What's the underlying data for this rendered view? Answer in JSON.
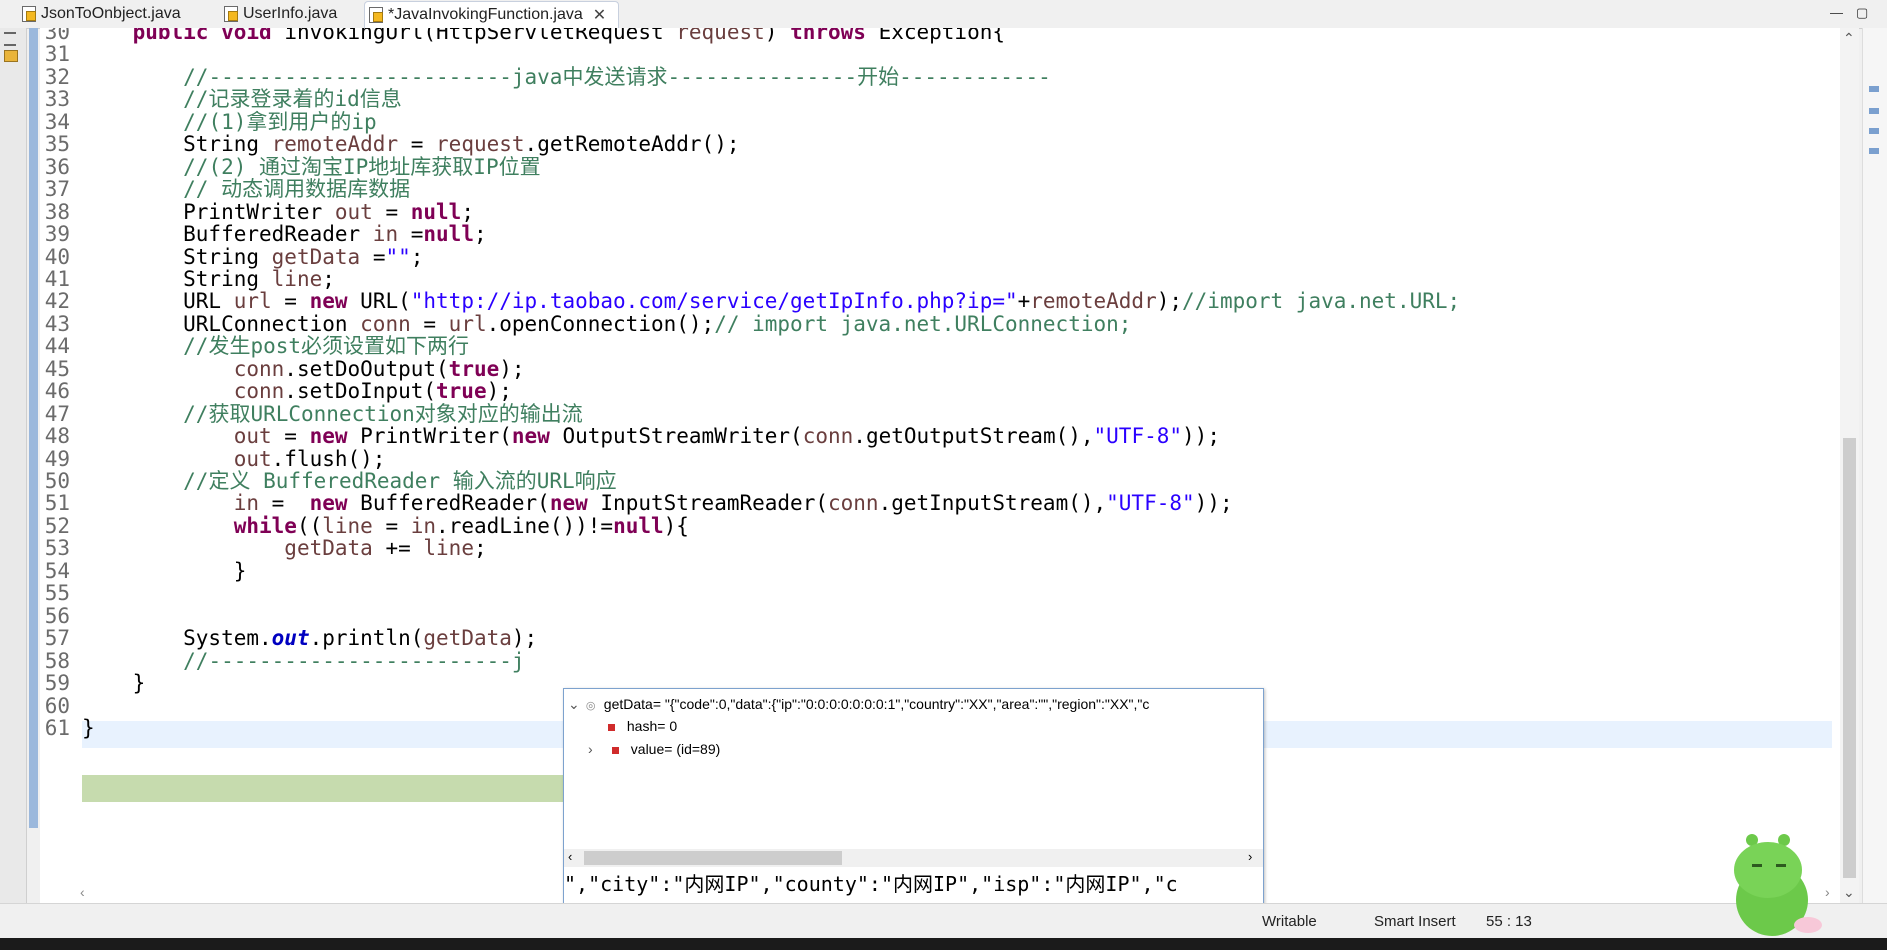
{
  "tabs": [
    {
      "label": "JsonToOnbject.java",
      "active": false
    },
    {
      "label": "UserInfo.java",
      "active": false
    },
    {
      "label": "*JavaInvokingFunction.java",
      "active": true
    }
  ],
  "editor": {
    "lines": [
      {
        "n": "30",
        "html": "    <span class=\"kw\">public</span> <span class=\"kw\">void</span> invokingUrl(HttpServletRequest <span class=\"vr\">request</span>) <span class=\"kw\">throws</span> Exception{"
      },
      {
        "n": "31",
        "html": ""
      },
      {
        "n": "32",
        "html": "        <span class=\"cm\">//------------------------java中发送请求---------------开始------------</span>"
      },
      {
        "n": "33",
        "html": "        <span class=\"cm\">//记录登录着的id信息</span>"
      },
      {
        "n": "34",
        "html": "        <span class=\"cm\">//(1)拿到用户的ip</span>"
      },
      {
        "n": "35",
        "html": "        String <span class=\"vr\">remoteAddr</span> = <span class=\"vr\">request</span>.getRemoteAddr();"
      },
      {
        "n": "36",
        "html": "        <span class=\"cm\">//(2) 通过淘宝IP地址库获取IP位置</span>"
      },
      {
        "n": "37",
        "html": "        <span class=\"cm\">// 动态调用数据库数据</span>"
      },
      {
        "n": "38",
        "html": "        PrintWriter <span class=\"vr\">out</span> = <span class=\"kw\">null</span>;"
      },
      {
        "n": "39",
        "html": "        BufferedReader <span class=\"vr\">in</span> =<span class=\"kw\">null</span>;"
      },
      {
        "n": "40",
        "html": "        String <span class=\"vr\">getData</span> =<span class=\"st\">\"\"</span>;"
      },
      {
        "n": "41",
        "html": "        String <span class=\"vr\">line</span>;"
      },
      {
        "n": "42",
        "html": "        URL <span class=\"vr\">url</span> = <span class=\"kw\">new</span> URL(<span class=\"st\">\"http://ip.taobao.com/service/getIpInfo.php?ip=\"</span>+<span class=\"vr\">remoteAddr</span>);<span class=\"cm\">//import java.net.URL;</span>"
      },
      {
        "n": "43",
        "html": "        URLConnection <span class=\"vr\">conn</span> = <span class=\"vr\">url</span>.openConnection();<span class=\"cm\">// import java.net.URLConnection;</span>"
      },
      {
        "n": "44",
        "html": "        <span class=\"cm\">//发生post必须设置如下两行</span>"
      },
      {
        "n": "45",
        "html": "            <span class=\"vr\">conn</span>.setDoOutput(<span class=\"kw\">true</span>);"
      },
      {
        "n": "46",
        "html": "            <span class=\"vr\">conn</span>.setDoInput(<span class=\"kw\">true</span>);"
      },
      {
        "n": "47",
        "html": "        <span class=\"cm\">//获取URLConnection对象对应的输出流</span>"
      },
      {
        "n": "48",
        "html": "            <span class=\"vr\">out</span> = <span class=\"kw\">new</span> PrintWriter(<span class=\"kw\">new</span> OutputStreamWriter(<span class=\"vr\">conn</span>.getOutputStream(),<span class=\"st\">\"UTF-8\"</span>));"
      },
      {
        "n": "49",
        "html": "            <span class=\"vr\">out</span>.flush();"
      },
      {
        "n": "50",
        "html": "        <span class=\"cm\">//定义 BufferedReader 输入流的URL响应</span>"
      },
      {
        "n": "51",
        "html": "            <span class=\"vr\">in</span> =  <span class=\"kw\">new</span> BufferedReader(<span class=\"kw\">new</span> InputStreamReader(<span class=\"vr\">conn</span>.getInputStream(),<span class=\"st\">\"UTF-8\"</span>));"
      },
      {
        "n": "52",
        "html": "            <span class=\"kw\">while</span>((<span class=\"vr\">line</span> = <span class=\"vr\">in</span>.readLine())!=<span class=\"kw\">null</span>){"
      },
      {
        "n": "53",
        "html": "                <span class=\"vr\">getData</span> += <span class=\"vr\">line</span>;"
      },
      {
        "n": "54",
        "html": "            }"
      },
      {
        "n": "55",
        "html": ""
      },
      {
        "n": "56",
        "html": ""
      },
      {
        "n": "57",
        "html": "        System.<span class=\"fld\">out</span>.println(<span class=\"vr\">getData</span>);"
      },
      {
        "n": "58",
        "html": "        <span class=\"cm\">//------------------------j</span>"
      },
      {
        "n": "59",
        "html": "    }"
      },
      {
        "n": "60",
        "html": ""
      },
      {
        "n": "61",
        "html": "}"
      }
    ]
  },
  "debug_popup": {
    "root_label": "getData= \"{\"code\":0,\"data\":{\"ip\":\"0:0:0:0:0:0:0:1\",\"country\":\"XX\",\"area\":\"\",\"region\":\"XX\",\"c",
    "hash_label": "hash= 0",
    "value_label": "value= (id=89)",
    "detail_text": "\",\"city\":\"内网IP\",\"county\":\"内网IP\",\"isp\":\"内网IP\",\"c"
  },
  "status": {
    "writable": "Writable",
    "insert_mode": "Smart Insert",
    "position": "55 : 13"
  },
  "colors": {
    "keyword": "#7f0055",
    "comment": "#3f7f5f",
    "string": "#2a00ff",
    "variable": "#6a3e3e",
    "current_line": "#e8f2fe",
    "debug_line": "#c6dbae"
  }
}
